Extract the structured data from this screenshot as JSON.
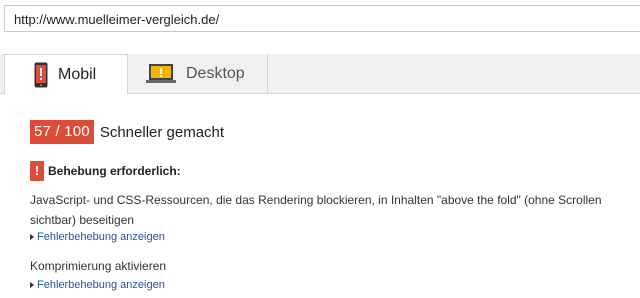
{
  "url_bar": {
    "url": "http://www.muelleimer-vergleich.de/"
  },
  "tabs": [
    {
      "label": "Mobil",
      "icon": "phone-icon",
      "active": true
    },
    {
      "label": "Desktop",
      "icon": "laptop-icon",
      "active": false
    }
  ],
  "result": {
    "score": "57 / 100",
    "title": "Schneller gemacht",
    "score_color": "#dd4b39"
  },
  "fix_required": {
    "heading": "Behebung erforderlich:",
    "rules": [
      {
        "text": "JavaScript- und CSS-Ressourcen, die das Rendering blockieren, in Inhalten \"above the fold\" (ohne Scrollen sichtbar) beseitigen",
        "link": "Fehlerbehebung anzeigen"
      },
      {
        "text": "Komprimierung aktivieren",
        "link": "Fehlerbehebung anzeigen"
      }
    ]
  }
}
